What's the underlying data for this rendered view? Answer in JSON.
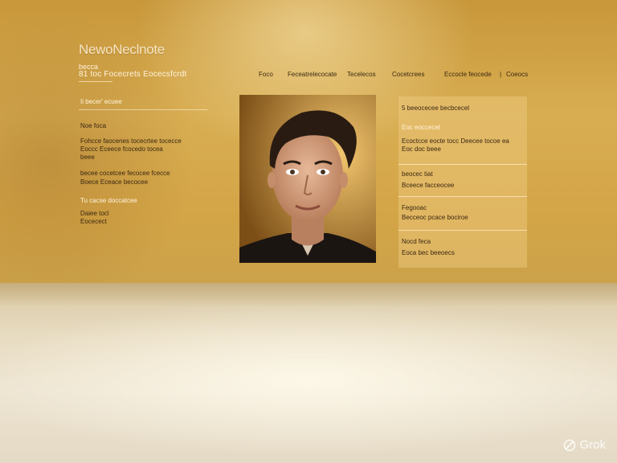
{
  "header": {
    "brand": "NewoNeclnote",
    "tagline_line1": "becca",
    "tagline_line2": "81 toc Focecrets Eocecsfcrdt"
  },
  "nav": {
    "items": [
      "Foco",
      "Feceatrelecocate",
      "Tecelecos",
      "Cocetcrees",
      "Eccocle feocede",
      "Coeocs"
    ]
  },
  "left_column": {
    "intro": "Ii becer' ecuee",
    "section1_title": "Noe foca",
    "section1_lines": [
      "Fohcce faocenes tocecrtee tocecce",
      "Eoccc Eceece fcocedo tocea",
      "beee"
    ],
    "section2_lines": [
      "becee cocetcee fecocee fcecce",
      "Boece Eceace becocee"
    ],
    "section3_title": "Tu cacse doccatcee",
    "section3_lines": [
      "Daiee tocl",
      "Eocecect"
    ]
  },
  "portrait": {
    "alt": "portrait-photo"
  },
  "right_panel": {
    "heading": "5  beeocecee becbcecel",
    "group1_title": "Eoc eoccecet",
    "group1_lines": [
      "Ecoctcce eocte tocc Deecee tocoe ea",
      "Eoc doc beee"
    ],
    "group2_title": "beocec tiat",
    "group2_line": "Bceece facceocee",
    "group3_title": "Fegooac",
    "group3_line": "Becceoc pcace bociroe",
    "group4_title": "Nocd feca",
    "group4_line": "Eoca bec beeoecs"
  },
  "watermark": {
    "text": "Grok"
  },
  "colors": {
    "gold": "#d4a547",
    "dark_text": "#3b2812",
    "light_text": "#fff3dc"
  }
}
